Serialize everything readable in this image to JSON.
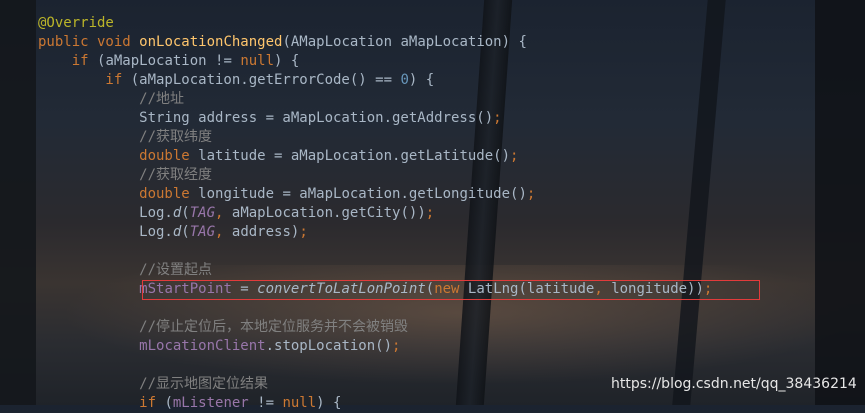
{
  "code_lines": [
    [
      {
        "t": "@Override",
        "c": "annot"
      }
    ],
    [
      {
        "t": "public void ",
        "c": "kw"
      },
      {
        "t": "onLocationChanged",
        "c": "fn"
      },
      {
        "t": "(AMapLocation aMapLocation) {",
        "c": "plain"
      }
    ],
    [
      {
        "t": "    if ",
        "c": "kw"
      },
      {
        "t": "(aMapLocation != ",
        "c": "plain"
      },
      {
        "t": "null",
        "c": "kw"
      },
      {
        "t": ") {",
        "c": "plain"
      }
    ],
    [
      {
        "t": "        if ",
        "c": "kw"
      },
      {
        "t": "(aMapLocation.getErrorCode() == ",
        "c": "plain"
      },
      {
        "t": "0",
        "c": "num"
      },
      {
        "t": ") {",
        "c": "plain"
      }
    ],
    [
      {
        "t": "            //地址",
        "c": "cmt"
      }
    ],
    [
      {
        "t": "            String address = aMapLocation.getAddress()",
        "c": "plain"
      },
      {
        "t": ";",
        "c": "kw"
      }
    ],
    [
      {
        "t": "            //获取纬度",
        "c": "cmt"
      }
    ],
    [
      {
        "t": "            double ",
        "c": "kw"
      },
      {
        "t": "latitude = aMapLocation.getLatitude()",
        "c": "plain"
      },
      {
        "t": ";",
        "c": "kw"
      }
    ],
    [
      {
        "t": "            //获取经度",
        "c": "cmt"
      }
    ],
    [
      {
        "t": "            double ",
        "c": "kw"
      },
      {
        "t": "longitude = aMapLocation.getLongitude()",
        "c": "plain"
      },
      {
        "t": ";",
        "c": "kw"
      }
    ],
    [
      {
        "t": "            Log.",
        "c": "plain"
      },
      {
        "t": "d",
        "c": "static"
      },
      {
        "t": "(",
        "c": "plain"
      },
      {
        "t": "TAG",
        "c": "const"
      },
      {
        "t": ", ",
        "c": "kw"
      },
      {
        "t": "aMapLocation.getCity())",
        "c": "plain"
      },
      {
        "t": ";",
        "c": "kw"
      }
    ],
    [
      {
        "t": "            Log.",
        "c": "plain"
      },
      {
        "t": "d",
        "c": "static"
      },
      {
        "t": "(",
        "c": "plain"
      },
      {
        "t": "TAG",
        "c": "const"
      },
      {
        "t": ", ",
        "c": "kw"
      },
      {
        "t": "address)",
        "c": "plain"
      },
      {
        "t": ";",
        "c": "kw"
      }
    ],
    [
      {
        "t": "",
        "c": "plain"
      }
    ],
    [
      {
        "t": "            //设置起点",
        "c": "cmt"
      }
    ],
    [
      {
        "t": "            ",
        "c": "plain"
      },
      {
        "t": "mStartPoint",
        "c": "field"
      },
      {
        "t": " = ",
        "c": "plain"
      },
      {
        "t": "convertToLatLonPoint",
        "c": "static"
      },
      {
        "t": "(",
        "c": "plain"
      },
      {
        "t": "new ",
        "c": "kw"
      },
      {
        "t": "LatLng(latitude",
        "c": "plain"
      },
      {
        "t": ", ",
        "c": "kw"
      },
      {
        "t": "longitude))",
        "c": "plain"
      },
      {
        "t": ";",
        "c": "kw"
      }
    ],
    [
      {
        "t": "",
        "c": "plain"
      }
    ],
    [
      {
        "t": "            //停止定位后，本地定位服务并不会被销毁",
        "c": "cmt"
      }
    ],
    [
      {
        "t": "            ",
        "c": "plain"
      },
      {
        "t": "mLocationClient",
        "c": "field"
      },
      {
        "t": ".stopLocation()",
        "c": "plain"
      },
      {
        "t": ";",
        "c": "kw"
      }
    ],
    [
      {
        "t": "",
        "c": "plain"
      }
    ],
    [
      {
        "t": "            //显示地图定位结果",
        "c": "cmt"
      }
    ],
    [
      {
        "t": "            if ",
        "c": "kw"
      },
      {
        "t": "(",
        "c": "plain"
      },
      {
        "t": "mListener",
        "c": "field"
      },
      {
        "t": " != ",
        "c": "plain"
      },
      {
        "t": "null",
        "c": "kw"
      },
      {
        "t": ") {",
        "c": "plain"
      }
    ]
  ],
  "watermark": "https://blog.csdn.net/qq_38436214",
  "colors": {
    "keyword": "#cc7832",
    "method_decl": "#ffc66d",
    "number": "#6897bb",
    "comment": "#808080",
    "field": "#9876aa",
    "annotation": "#bbb529",
    "highlight_border": "#e23b3b"
  }
}
